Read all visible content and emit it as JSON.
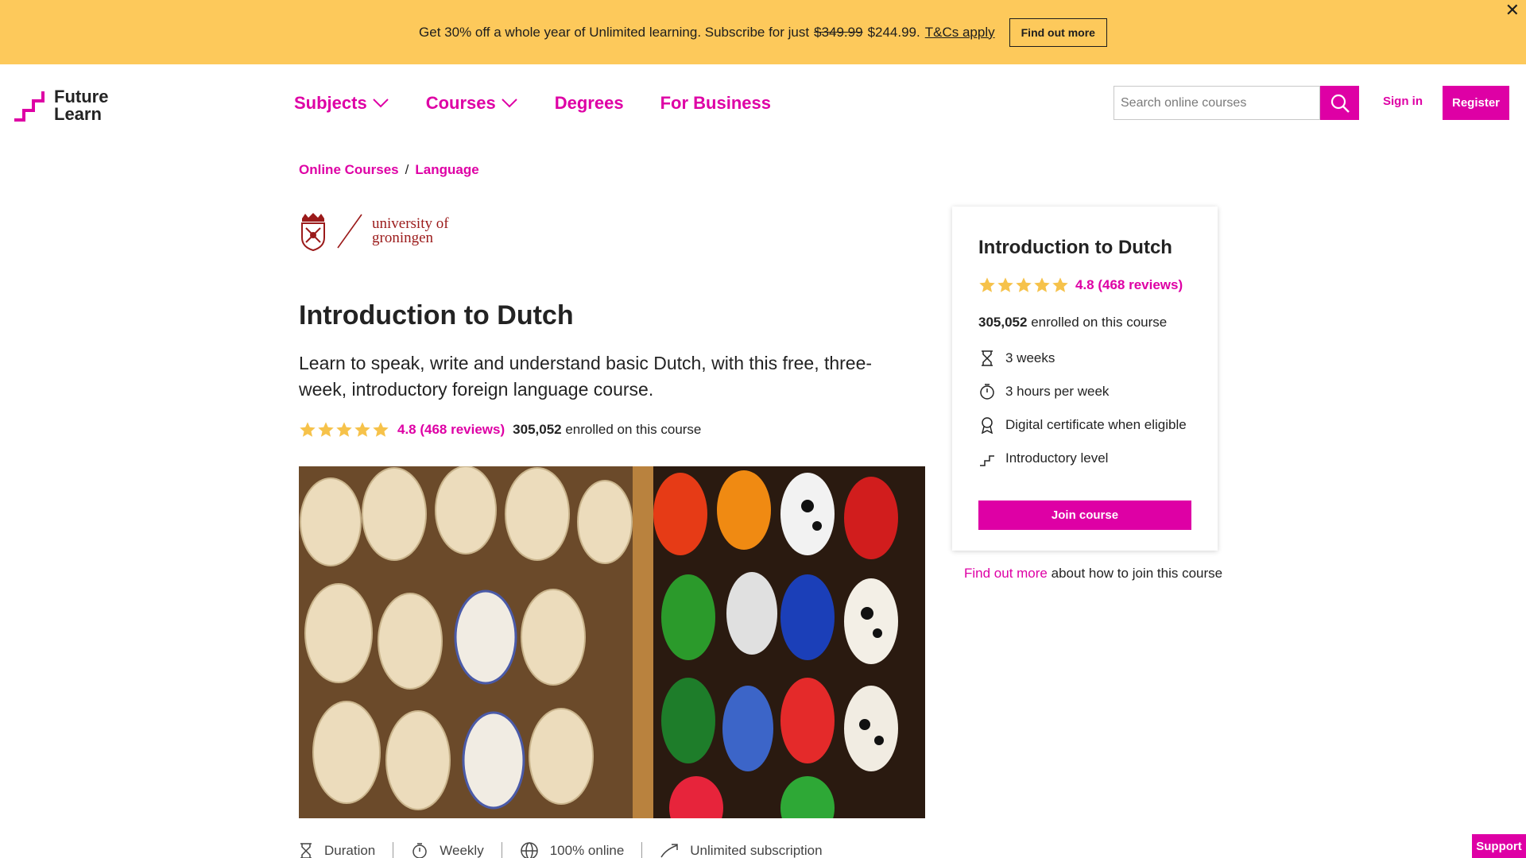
{
  "promo": {
    "text_before": "Get 30% off a whole year of Unlimited learning. Subscribe for just",
    "old_price": "$349.99",
    "new_price": "$244.99.",
    "tcs": "T&Cs apply",
    "button": "Find out more",
    "close": "✕",
    "background": "#fdc95b"
  },
  "header": {
    "logo_line1": "Future",
    "logo_line2": "Learn",
    "nav": [
      {
        "label": "Subjects"
      },
      {
        "label": "Courses"
      },
      {
        "label": "Degrees"
      },
      {
        "label": "For Business"
      }
    ],
    "search_placeholder": "Search online courses",
    "sign_in": "Sign in",
    "register": "Register",
    "accent": "#de00a5"
  },
  "breadcrumb": {
    "items": [
      "Online Courses",
      "Language"
    ],
    "separator": "/"
  },
  "partner": {
    "line1": "university of",
    "line2": "groningen"
  },
  "course": {
    "title": "Introduction to Dutch",
    "description": "Learn to speak, write and understand basic Dutch, with this free, three-week, introductory foreign language course.",
    "rating": 4.8,
    "reviews_label": "4.8 (468 reviews)",
    "enrolled_count": "305,052",
    "enrolled_text": "enrolled on this course"
  },
  "features": [
    {
      "label": "Duration",
      "icon": "hourglass-icon"
    },
    {
      "label": "Weekly",
      "icon": "stopwatch-icon"
    },
    {
      "label": "100% online",
      "icon": "globe-icon"
    },
    {
      "label": "Unlimited subscription",
      "icon": "arrow-up-right-icon"
    }
  ],
  "card": {
    "title": "Introduction to Dutch",
    "reviews_label": "4.8 (468 reviews)",
    "enrolled_count": "305,052",
    "enrolled_text": "enrolled on this course",
    "details": [
      {
        "label": "3 weeks",
        "icon": "hourglass-icon"
      },
      {
        "label": "3 hours per week",
        "icon": "stopwatch-icon"
      },
      {
        "label": "Digital certificate when eligible",
        "icon": "certificate-icon"
      },
      {
        "label": "Introductory level",
        "icon": "steps-icon"
      }
    ],
    "join_button": "Join course",
    "note_link": "Find out more",
    "note_text": "about how to join this course"
  },
  "support": "Support"
}
